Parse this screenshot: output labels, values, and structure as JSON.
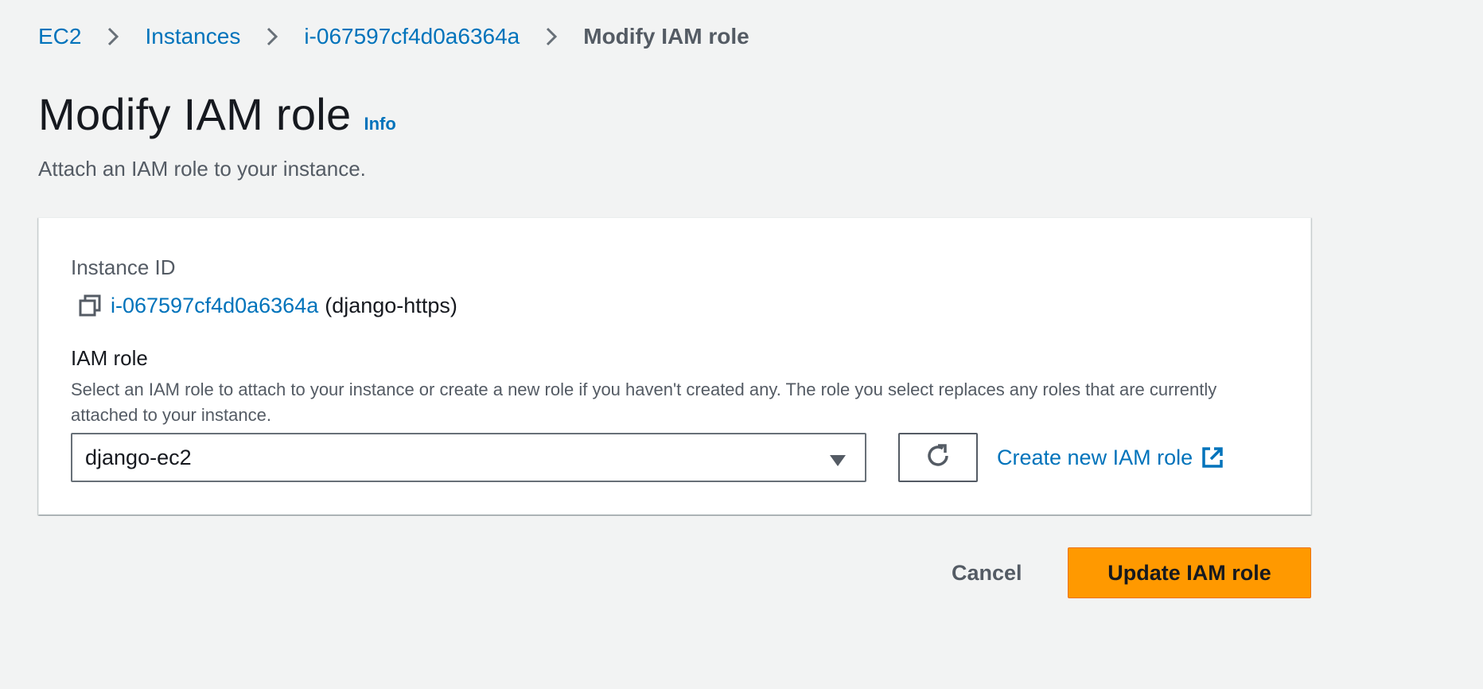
{
  "breadcrumb": {
    "items": [
      {
        "label": "EC2"
      },
      {
        "label": "Instances"
      },
      {
        "label": "i-067597cf4d0a6364a"
      }
    ],
    "current": "Modify IAM role"
  },
  "header": {
    "title": "Modify IAM role",
    "info_label": "Info",
    "description": "Attach an IAM role to your instance."
  },
  "instance": {
    "label": "Instance ID",
    "id": "i-067597cf4d0a6364a",
    "name": "(django-https)",
    "copy_icon": "copy-icon"
  },
  "iam_role": {
    "label": "IAM role",
    "description": "Select an IAM role to attach to your instance or create a new role if you haven't created any. The role you select replaces any roles that are currently attached to your instance.",
    "selected_value": "django-ec2",
    "refresh_icon": "refresh-icon",
    "create_label": "Create new IAM role",
    "external_icon": "external-link-icon"
  },
  "actions": {
    "cancel_label": "Cancel",
    "submit_label": "Update IAM role"
  },
  "colors": {
    "link": "#0073bb",
    "primary": "#ff9900",
    "background": "#f2f3f3",
    "text": "#16191f",
    "secondary_text": "#545b64"
  }
}
